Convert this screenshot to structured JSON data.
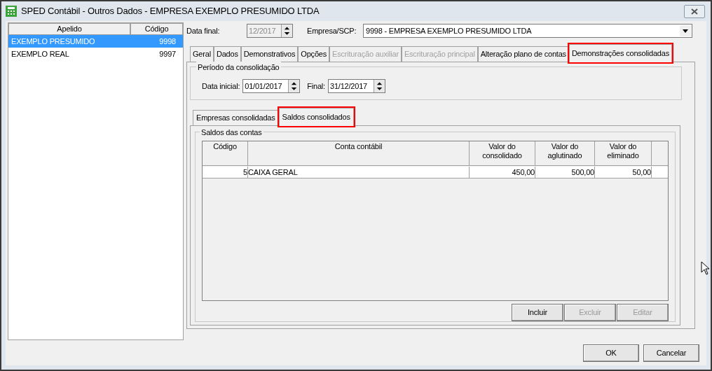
{
  "window": {
    "title": "SPED Contábil - Outros Dados - EMPRESA EXEMPLO PRESUMIDO LTDA"
  },
  "company_list": {
    "columns": [
      "Apelido",
      "Código"
    ],
    "rows": [
      {
        "cells": [
          "EXEMPLO PRESUMIDO",
          "9998"
        ],
        "selected": true
      },
      {
        "cells": [
          "EXEMPLO REAL",
          "9997"
        ],
        "selected": false
      }
    ]
  },
  "header": {
    "date_label": "Data final:",
    "date_value": "12/2017",
    "date_disabled": true,
    "company_label": "Empresa/SCP:",
    "company_value": "9998 - EMPRESA EXEMPLO PRESUMIDO LTDA"
  },
  "tabs": [
    {
      "label": "Geral",
      "selected": false,
      "disabled": false,
      "highlighted": false
    },
    {
      "label": "Dados",
      "selected": false,
      "disabled": false,
      "highlighted": false
    },
    {
      "label": "Demonstrativos",
      "selected": false,
      "disabled": false,
      "highlighted": false
    },
    {
      "label": "Opções",
      "selected": false,
      "disabled": false,
      "highlighted": false
    },
    {
      "label": "Escrituração auxiliar",
      "selected": false,
      "disabled": true,
      "highlighted": false
    },
    {
      "label": "Escrituração principal",
      "selected": false,
      "disabled": true,
      "highlighted": false
    },
    {
      "label": "Alteração plano de contas",
      "selected": false,
      "disabled": false,
      "highlighted": false
    },
    {
      "label": "Demonstrações consolidadas",
      "selected": true,
      "disabled": false,
      "highlighted": true
    }
  ],
  "period": {
    "title": "Período da consolidação",
    "start_label": "Data inicial:",
    "start_value": "01/01/2017",
    "end_label": "Final:",
    "end_value": "31/12/2017"
  },
  "sub_tabs": [
    {
      "label": "Empresas consolidadas",
      "selected": false,
      "highlighted": false
    },
    {
      "label": "Saldos consolidados",
      "selected": true,
      "highlighted": true
    }
  ],
  "balances": {
    "title": "Saldos das contas",
    "columns": [
      "Código",
      "Conta contábil",
      "Valor do\nconsolidado",
      "Valor do\naglutinado",
      "Valor do\neliminado"
    ],
    "rows": [
      {
        "cells": [
          "5",
          "CAIXA GERAL",
          "450,00",
          "500,00",
          "50,00"
        ]
      }
    ],
    "buttons": [
      {
        "label": "Incluir",
        "disabled": false
      },
      {
        "label": "Excluir",
        "disabled": true
      },
      {
        "label": "Editar",
        "disabled": true
      }
    ]
  },
  "buttons": [
    {
      "label": "OK",
      "disabled": false
    },
    {
      "label": "Cancelar",
      "disabled": false
    }
  ]
}
